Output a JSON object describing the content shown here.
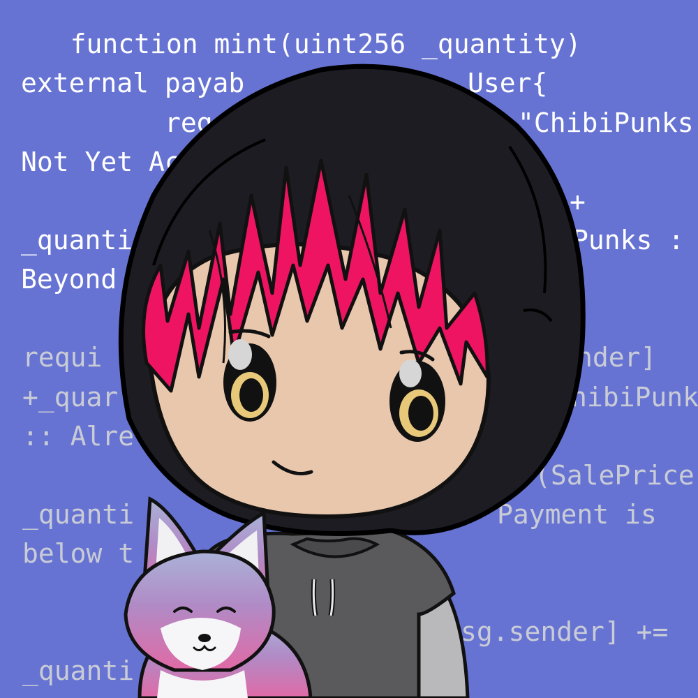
{
  "code_lines": [
    "   function mint(uint256 _quantity)",
    "external payab",
    "User{",
    "reg",
    "\"ChibiPunks",
    "Not Yet Ac",
    "+",
    "_quanti",
    "Punks :",
    "Beyond",
    "requi",
    "nder]",
    "+_quar",
    "hibiPunk",
    ":: Alre",
    "(SalePrice",
    "_quanti",
    "Payment is",
    "below t",
    "sg.sender] +=",
    "_quanti"
  ],
  "colors": {
    "background": "#6673d2",
    "code_text_bright": "#ffffff",
    "code_text_faded": "#c9ccd6",
    "hood": "#1d1c22",
    "hair": "#ee1461",
    "skin": "#e8c7ad",
    "shirt": "#5a5a5c",
    "sleeve": "#b9b9bb",
    "eye_iris": "#e8c97a",
    "fox_top": "#9a82c8",
    "fox_bottom": "#e06aa6"
  },
  "icons": [
    "chibi-character",
    "fox-companion"
  ]
}
